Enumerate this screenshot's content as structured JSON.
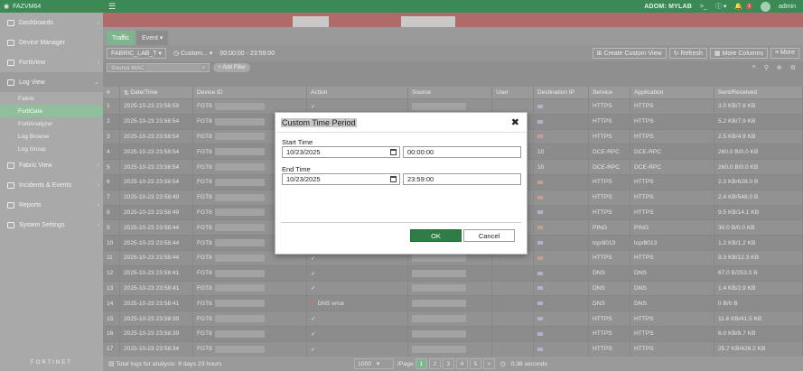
{
  "topbar": {
    "device_name": "FAZVM64",
    "adom_label": "ADOM: MYLAB",
    "notification_count": "1",
    "user_name": "admin"
  },
  "sidebar": {
    "items": [
      {
        "label": "Dashboards"
      },
      {
        "label": "Device Manager"
      },
      {
        "label": "FortiView"
      },
      {
        "label": "Log View"
      },
      {
        "label": "Fabric View"
      },
      {
        "label": "Incidents & Events"
      },
      {
        "label": "Reports"
      },
      {
        "label": "System Settings"
      }
    ],
    "log_view_subitems": [
      "Fabric",
      "FortiGate",
      "FortiAnalyzer",
      "Log Browse",
      "Log Group"
    ],
    "footer_logo": "FORTINET"
  },
  "tabs": [
    {
      "label": "Traffic"
    },
    {
      "label": "Event"
    }
  ],
  "toolbar": {
    "device_select": "FABRIC_LAB_T",
    "time_select": "Custom...",
    "time_range": "00:00:00 - 23:59:00",
    "create_view": "Create Custom View",
    "refresh": "Refresh",
    "more_columns": "More Columns",
    "more": "More"
  },
  "filter": {
    "chip_label": "Source MAC",
    "add_filter": "Add Filter"
  },
  "table": {
    "columns": [
      "#",
      "Date/Time",
      "Device ID",
      "Action",
      "Source",
      "User",
      "Destination IP",
      "Service",
      "Application",
      "Sent/Received"
    ],
    "rows": [
      {
        "n": "1",
        "dt": "2025-10-23 23:58:59",
        "dev": "FGT8",
        "act": "",
        "dst": "",
        "svc": "HTTPS",
        "app": "HTTPS",
        "sr": "3.0 KB/7.6 KB",
        "flag": "us"
      },
      {
        "n": "2",
        "dt": "2025-10-23 23:58:54",
        "dev": "FGT8",
        "act": "",
        "dst": "",
        "svc": "HTTPS",
        "app": "HTTPS",
        "sr": "5.2 KB/7.9 KB",
        "flag": "us"
      },
      {
        "n": "3",
        "dt": "2025-10-23 23:58:54",
        "dev": "FGT8",
        "act": "",
        "dst": "",
        "svc": "HTTPS",
        "app": "HTTPS",
        "sr": "2.5 KB/4.9 KB",
        "flag": "ca"
      },
      {
        "n": "4",
        "dt": "2025-10-23 23:58:54",
        "dev": "FGT8",
        "act": "",
        "dst": "10",
        "svc": "DCE-RPC",
        "app": "DCE-RPC",
        "sr": "260.0 B/0.0 KB",
        "flag": ""
      },
      {
        "n": "5",
        "dt": "2025-10-23 23:58:54",
        "dev": "FGT8",
        "act": "",
        "dst": "10",
        "svc": "DCE-RPC",
        "app": "DCE-RPC",
        "sr": "260.0 B/0.0 KB",
        "flag": ""
      },
      {
        "n": "6",
        "dt": "2025-10-23 23:58:54",
        "dev": "FGT8",
        "act": "",
        "dst": "",
        "svc": "HTTPS",
        "app": "HTTPS",
        "sr": "2.3 KB/628.0 B",
        "flag": "ca"
      },
      {
        "n": "7",
        "dt": "2025-10-23 23:58:49",
        "dev": "FGT8",
        "act": "",
        "dst": "",
        "svc": "HTTPS",
        "app": "HTTPS",
        "sr": "2.4 KB/548.0 B",
        "flag": "ca"
      },
      {
        "n": "8",
        "dt": "2025-10-23 23:58:49",
        "dev": "FGT8",
        "act": "",
        "dst": "",
        "svc": "HTTPS",
        "app": "HTTPS",
        "sr": "9.5 KB/14.1 KB",
        "flag": "us"
      },
      {
        "n": "9",
        "dt": "2025-10-23 23:58:44",
        "dev": "FGT8",
        "act": "",
        "dst": "",
        "svc": "PING",
        "app": "PING",
        "sr": "30.0 B/0.0 KB",
        "flag": "ca"
      },
      {
        "n": "10",
        "dt": "2025-10-23 23:58:44",
        "dev": "FGT8",
        "act": "",
        "dst": "",
        "svc": "tcp/8013",
        "app": "tcp/8013",
        "sr": "1.2 KB/1.2 KB",
        "flag": "us"
      },
      {
        "n": "11",
        "dt": "2025-10-23 23:58:44",
        "dev": "FGT8",
        "act": "",
        "dst": "",
        "svc": "HTTPS",
        "app": "HTTPS",
        "sr": "9.3 KB/12.3 KB",
        "flag": "ca"
      },
      {
        "n": "12",
        "dt": "2025-10-23 23:58:41",
        "dev": "FGT8",
        "act": "",
        "dst": "",
        "svc": "DNS",
        "app": "DNS",
        "sr": "67.0 B/253.0 B",
        "flag": "us"
      },
      {
        "n": "13",
        "dt": "2025-10-23 23:58:41",
        "dev": "FGT8",
        "act": "",
        "dst": "",
        "svc": "DNS",
        "app": "DNS",
        "sr": "1.4 KB/2.9 KB",
        "flag": "us"
      },
      {
        "n": "14",
        "dt": "2025-10-23 23:58:41",
        "dev": "FGT8",
        "act": "DNS error",
        "dst": "",
        "svc": "DNS",
        "app": "DNS",
        "sr": "0 B/0 B",
        "flag": "us"
      },
      {
        "n": "15",
        "dt": "2025-10-23 23:58:39",
        "dev": "FGT8",
        "act": "",
        "dst": "",
        "svc": "HTTPS",
        "app": "HTTPS",
        "sr": "11.6 KB/41.5 KB",
        "flag": "us"
      },
      {
        "n": "16",
        "dt": "2025-10-23 23:58:39",
        "dev": "FGT8",
        "act": "",
        "dst": "",
        "svc": "HTTPS",
        "app": "HTTPS",
        "sr": "6.0 KB/8.7 KB",
        "flag": "us"
      },
      {
        "n": "17",
        "dt": "2025-10-23 23:58:34",
        "dev": "FGT8",
        "act": "",
        "dst": "",
        "svc": "HTTPS",
        "app": "HTTPS",
        "sr": "25.7 KB/426.2 KB",
        "flag": "us"
      }
    ]
  },
  "statusbar": {
    "total_text": "Total logs for analysis: 9 days 23 hours",
    "page_size": "1000",
    "page_label": "/Page",
    "pages": [
      "1",
      "2",
      "3",
      "4",
      "5"
    ],
    "next": ">",
    "elapsed": "0.38 seconds"
  },
  "dialog": {
    "title": "Custom Time Period",
    "start_label": "Start Time",
    "start_date": "10/23/2025",
    "start_time": "00:00:00",
    "end_label": "End Time",
    "end_date": "10/23/2025",
    "end_time": "23:59:00",
    "ok_label": "OK",
    "cancel_label": "Cancel"
  }
}
